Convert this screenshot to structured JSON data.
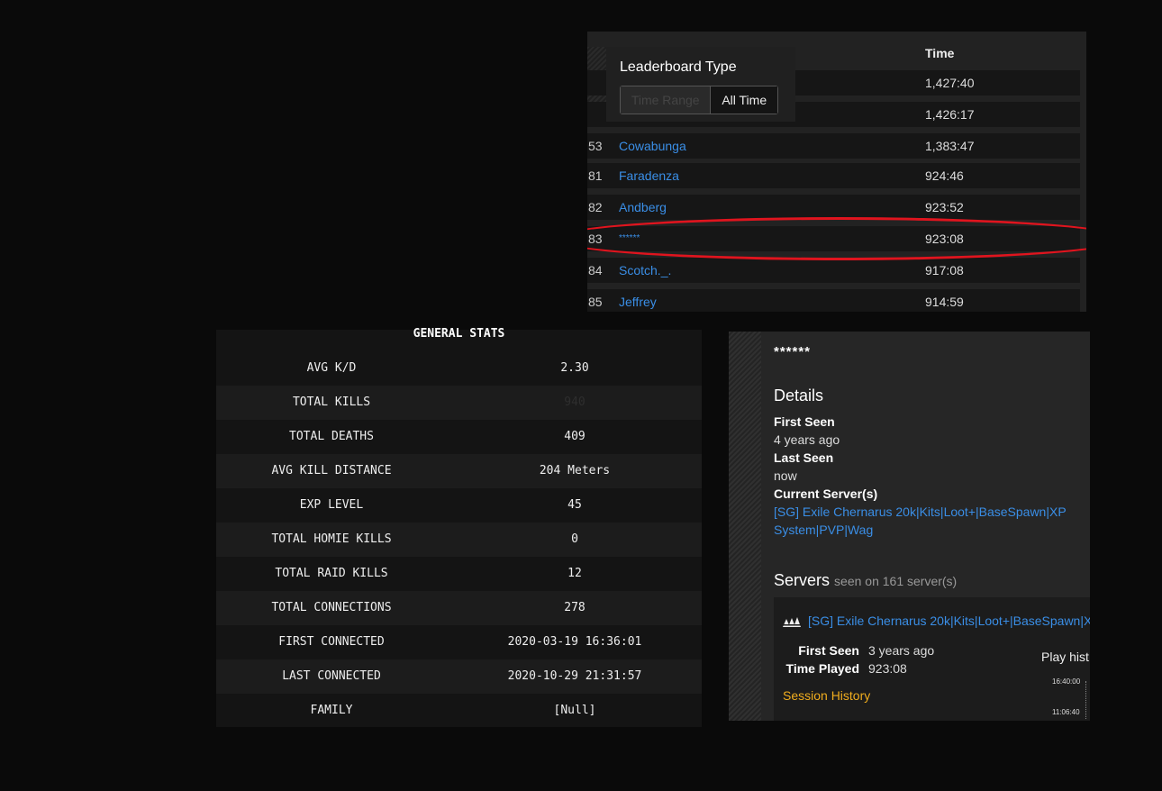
{
  "leaderboard": {
    "column_time": "Time",
    "popup": {
      "title": "Leaderboard Type",
      "option_time_range": "Time Range",
      "option_all_time": "All Time"
    },
    "rows": [
      {
        "rank": "",
        "name": "",
        "time": "1,427:40"
      },
      {
        "rank": "",
        "name": "",
        "time": "1,426:17"
      },
      {
        "rank": "53",
        "name": "Cowabunga",
        "time": "1,383:47"
      },
      {
        "rank": "81",
        "name": "Faradenza",
        "time": "924:46"
      },
      {
        "rank": "82",
        "name": "Andberg",
        "time": "923:52"
      },
      {
        "rank": "83",
        "name": "******",
        "time": "923:08"
      },
      {
        "rank": "84",
        "name": "Scotch._.",
        "time": "917:08"
      },
      {
        "rank": "85",
        "name": "Jeffrey",
        "time": "914:59"
      }
    ]
  },
  "general_stats": {
    "title": "GENERAL STATS",
    "rows": [
      {
        "label": "AVG K/D",
        "value": "2.30"
      },
      {
        "label": "TOTAL KILLS",
        "value": "940"
      },
      {
        "label": "TOTAL DEATHS",
        "value": "409"
      },
      {
        "label": "AVG KILL DISTANCE",
        "value": "204 Meters"
      },
      {
        "label": "EXP LEVEL",
        "value": "45"
      },
      {
        "label": "TOTAL HOMIE KILLS",
        "value": "0"
      },
      {
        "label": "TOTAL RAID KILLS",
        "value": "12"
      },
      {
        "label": "TOTAL CONNECTIONS",
        "value": "278"
      },
      {
        "label": "FIRST CONNECTED",
        "value": "2020-03-19 16:36:01"
      },
      {
        "label": "LAST CONNECTED",
        "value": "2020-10-29 21:31:57"
      },
      {
        "label": "FAMILY",
        "value": "[Null]"
      }
    ]
  },
  "player": {
    "name": "******",
    "details_heading": "Details",
    "first_seen_label": "First Seen",
    "first_seen_value": "4 years ago",
    "last_seen_label": "Last Seen",
    "last_seen_value": "now",
    "current_servers_label": "Current Server(s)",
    "current_server_link": "[SG] Exile Chernarus 20k|Kits|Loot+|BaseSpawn|XP System|PVP|Wag",
    "servers_heading": "Servers",
    "servers_seen": "seen on 161 server(s)",
    "server_card": {
      "name": "[SG] Exile Chernarus 20k|Kits|Loot+|BaseSpawn|X",
      "first_seen_label": "First Seen",
      "first_seen_value": "3 years ago",
      "time_played_label": "Time Played",
      "time_played_value": "923:08",
      "session_history": "Session History",
      "play_history": "Play hist",
      "tick_1": "16:40:00",
      "tick_2": "11:06:40"
    }
  },
  "colors": {
    "link": "#3a8ee6",
    "highlight": "#e0141e",
    "session_link": "#f0ad1e"
  },
  "icons": {
    "game_logo": "arma-logo-icon"
  }
}
